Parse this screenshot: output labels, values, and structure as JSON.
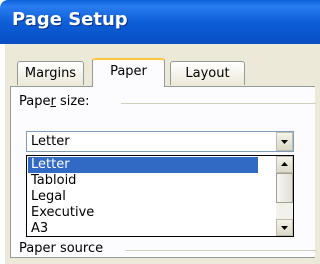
{
  "window": {
    "title": "Page Setup"
  },
  "tabs": [
    {
      "label": "Margins"
    },
    {
      "label": "Paper"
    },
    {
      "label": "Layout"
    }
  ],
  "paper_size": {
    "label_pre": "Pape",
    "label_accel": "r",
    "label_post": " size:",
    "selected": "Letter",
    "options": [
      "Letter",
      "Tabloid",
      "Legal",
      "Executive",
      "A3"
    ]
  },
  "paper_source": {
    "label": "Paper source"
  }
}
